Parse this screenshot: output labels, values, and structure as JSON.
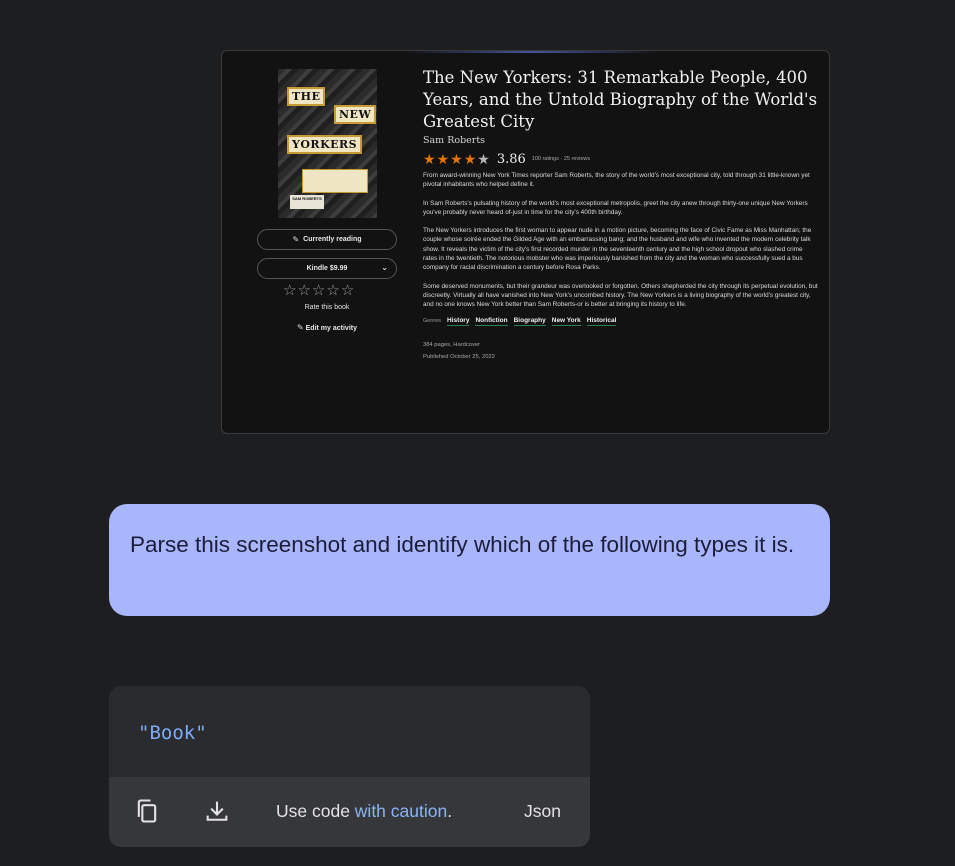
{
  "book": {
    "cover": {
      "line1": "THE",
      "line2": "NEW",
      "line3": "YORKERS",
      "author": "SAM ROBERTS"
    },
    "shelf_button": "Currently reading",
    "buy_button": "Kindle $9.99",
    "rate_label": "Rate this book",
    "edit_label": "Edit my activity",
    "title": "The New Yorkers: 31 Remarkable People, 400 Years, and the Untold Biography of the World's Greatest City",
    "author": "Sam Roberts",
    "average_rating": "3.86",
    "average_stars": 3.86,
    "ratings_meta": "100 ratings · 25 reviews",
    "description": [
      "From award-winning New York Times reporter Sam Roberts, the story of the world's most exceptional city, told through 31 little-known yet pivotal inhabitants who helped define it.",
      "In Sam Roberts's pulsating history of the world's most exceptional metropolis, greet the city anew through thirty-one unique New Yorkers you've probably never heard of-just in time for the city's 400th birthday.",
      "The New Yorkers introduces the first woman to appear nude in a motion picture, becoming the face of Civic Fame as Miss Manhattan; the couple whose soirée ended the Gilded Age with an embarrassing bang; and the husband and wife who invented the modern celebrity talk show. It reveals the victim of the city's first recorded murder in the seventeenth century and the high school dropout who slashed crime rates in the twentieth. The notorious mobster who was imperiously banished from the city and the woman who successfully sued a bus company for racial discrimination a century before Rosa Parks.",
      "Some deserved monuments, but their grandeur was overlooked or forgotten. Others shepherded the city through its perpetual evolution, but discreetly. Virtually all have vanished into New York's uncombed history. The New Yorkers is a living biography of the world's greatest city, and no one knows New York better than Sam Roberts-or is better at bringing its history to life."
    ],
    "genres_label": "Genres",
    "genres": [
      "History",
      "Nonfiction",
      "Biography",
      "New York",
      "Historical"
    ],
    "pages": "384 pages, Hardcover",
    "published": "Published October 25, 2022"
  },
  "chat": {
    "prompt": "Parse this screenshot and identify which of the following types it is."
  },
  "code_block": {
    "content": "\"Book\"",
    "caution_prefix": "Use code ",
    "caution_link": "with caution",
    "caution_suffix": ".",
    "language": "Json",
    "icons": [
      "copy-icon",
      "download-icon"
    ]
  },
  "colors": {
    "page_bg": "#1d1e20",
    "bubble_bg": "#aab6fb",
    "star_on": "#e87400",
    "link": "#8ab4f8",
    "code_text": "#7cacf8"
  }
}
